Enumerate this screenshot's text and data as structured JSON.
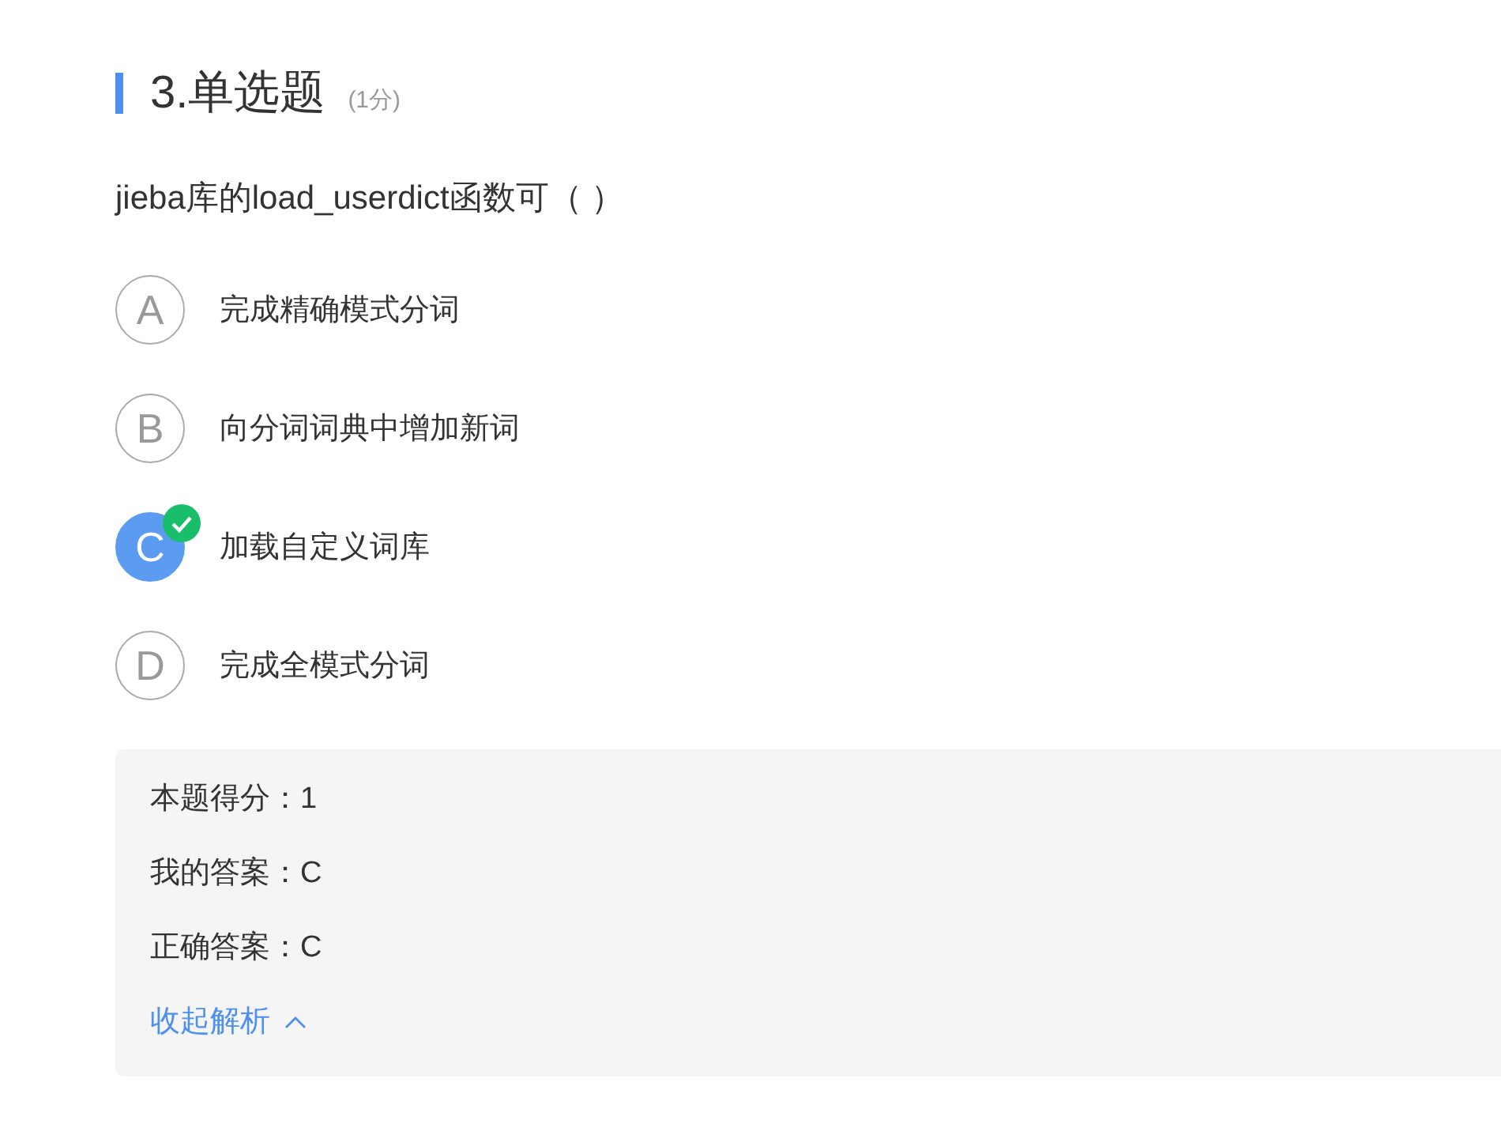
{
  "question": {
    "title": "3.单选题",
    "score": "(1分)",
    "stem": "jieba库的load_userdict函数可（ ）"
  },
  "options": [
    {
      "letter": "A",
      "text": "完成精确模式分词",
      "selected": false
    },
    {
      "letter": "B",
      "text": "向分词词典中增加新词",
      "selected": false
    },
    {
      "letter": "C",
      "text": "加载自定义词库",
      "selected": true
    },
    {
      "letter": "D",
      "text": "完成全模式分词",
      "selected": false
    }
  ],
  "analysis": {
    "lines": [
      "本题得分：1",
      "我的答案：C",
      "正确答案：C"
    ],
    "toggle": {
      "label": "收起解析",
      "expanded": true
    }
  }
}
